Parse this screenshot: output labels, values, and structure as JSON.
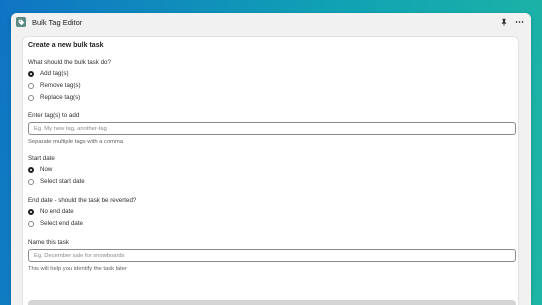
{
  "window": {
    "title": "Bulk Tag Editor",
    "app_icon": "tag-icon",
    "pin_icon": "pin-icon",
    "more_icon": "more-horizontal-icon"
  },
  "form": {
    "title": "Create a new bulk task",
    "action": {
      "label": "What should the bulk task do?",
      "options": [
        "Add tag(s)",
        "Remove tag(s)",
        "Replace tag(s)"
      ],
      "selected": "Add tag(s)"
    },
    "tags": {
      "label": "Enter tag(s) to add",
      "placeholder": "Eg. My new tag, another-tag",
      "value": "",
      "help": "Separate multiple tags with a comma"
    },
    "start_date": {
      "label": "Start date",
      "options": [
        "Now",
        "Select start date"
      ],
      "selected": "Now"
    },
    "end_date": {
      "label": "End date - should the task be reverted?",
      "options": [
        "No end date",
        "Select end date"
      ],
      "selected": "No end date"
    },
    "name": {
      "label": "Name this task",
      "placeholder": "Eg. December sale for snowboards",
      "value": "",
      "help": "This will help you identify the task later"
    }
  },
  "colors": {
    "background_start": "#0f74c4",
    "background_end": "#1fb5a4",
    "window_bg": "#f1f1f1",
    "card_bg": "#ffffff",
    "app_icon_bg": "#5a8a83",
    "submit_bg": "#d4d4d4"
  }
}
